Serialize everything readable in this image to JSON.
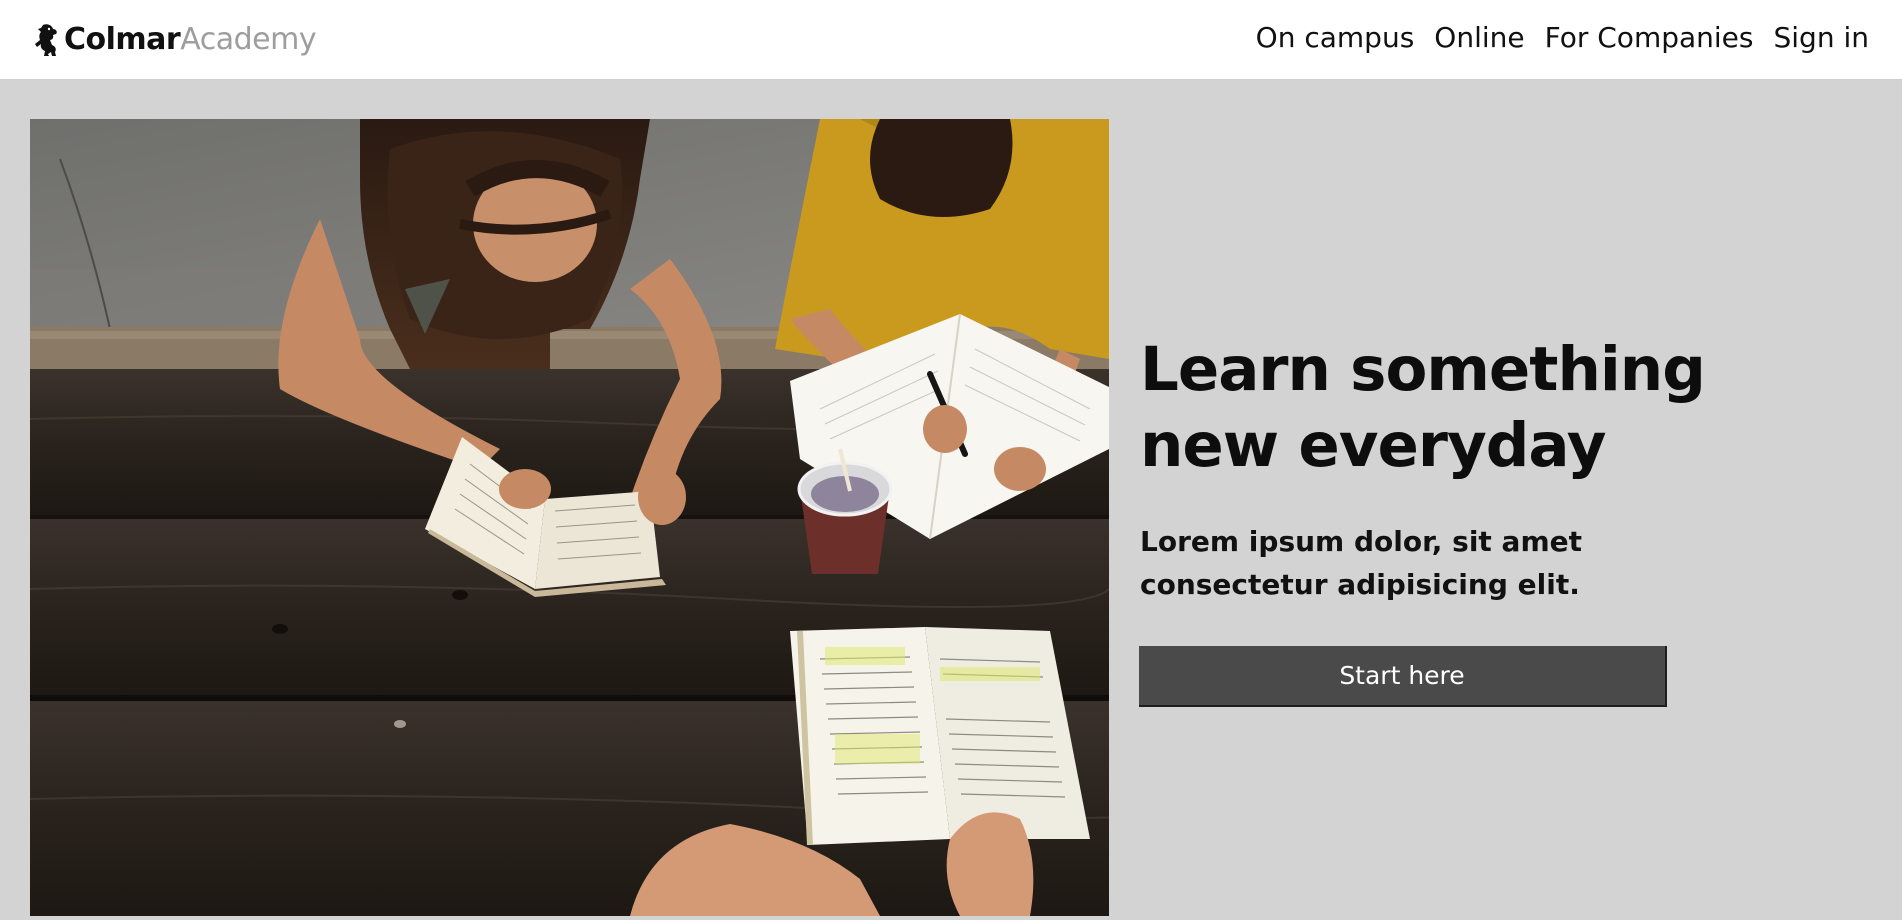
{
  "header": {
    "brand_bold": "Colmar",
    "brand_light": "Academy",
    "brand_icon": "lion-rampant-icon",
    "nav": [
      {
        "label": "On campus"
      },
      {
        "label": "Online"
      },
      {
        "label": "For Companies"
      },
      {
        "label": "Sign in"
      }
    ]
  },
  "hero": {
    "title_line1": "Learn something",
    "title_line2": "new everyday",
    "subtitle_line1": "Lorem ipsum dolor, sit amet",
    "subtitle_line2": "consectetur adipisicing elit.",
    "cta_label": "Start here"
  },
  "colors": {
    "page_background": "#d3d3d3",
    "header_background": "#ffffff",
    "brand_secondary": "#9e9e9e",
    "cta_background": "#4a4a4a",
    "cta_text": "#ffffff"
  }
}
